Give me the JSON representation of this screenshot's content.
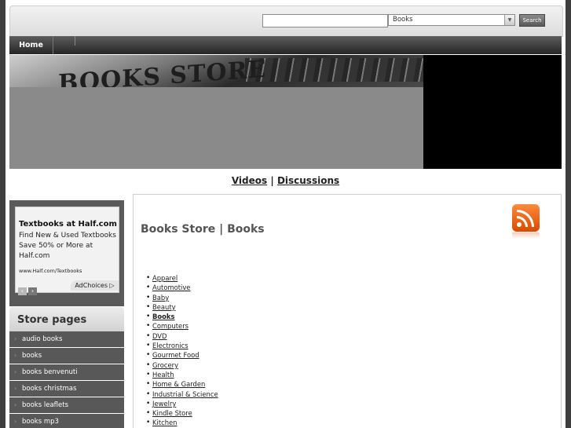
{
  "header": {
    "search_placeholder": "",
    "category_selected": "Books",
    "search_button": "Search"
  },
  "nav": {
    "home": "Home"
  },
  "banner": {
    "logo_text": "BOOKS STORE"
  },
  "media_links": {
    "videos": "Videos",
    "separator": "|",
    "discussions": "Discussions"
  },
  "ad": {
    "title": "Textbooks at Half.com",
    "body": "Find New & Used Textbooks Save 50% or More at Half.com",
    "url": "www.Half.com/Textbooks",
    "prev": "‹",
    "next": "›",
    "adchoices": "AdChoices ▷"
  },
  "sidebar": {
    "title": "Store pages",
    "items": [
      {
        "label": "audio books"
      },
      {
        "label": "books"
      },
      {
        "label": "books benvenuti"
      },
      {
        "label": "books christmas"
      },
      {
        "label": "books leaflets"
      },
      {
        "label": "books mp3"
      }
    ]
  },
  "main": {
    "title": "Books Store | Books",
    "categories": [
      {
        "label": "Apparel"
      },
      {
        "label": "Automotive"
      },
      {
        "label": "Baby"
      },
      {
        "label": "Beauty"
      },
      {
        "label": "Books",
        "active": true
      },
      {
        "label": "Computers"
      },
      {
        "label": "DVD"
      },
      {
        "label": "Electronics"
      },
      {
        "label": "Gourmet Food"
      },
      {
        "label": "Grocery"
      },
      {
        "label": "Health"
      },
      {
        "label": "Home & Garden"
      },
      {
        "label": "Industrial & Science"
      },
      {
        "label": "Jewelry"
      },
      {
        "label": "Kindle Store"
      },
      {
        "label": "Kitchen"
      }
    ]
  }
}
